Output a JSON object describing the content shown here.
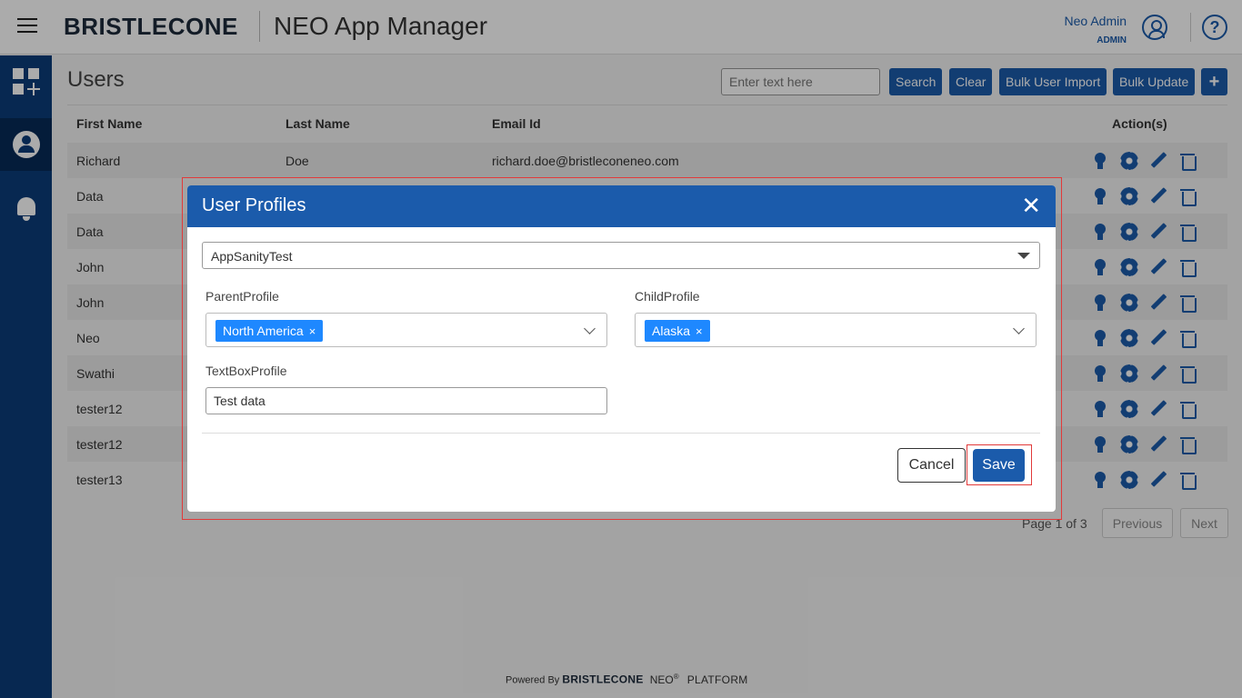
{
  "header": {
    "brand": "BRISTLECONE",
    "app_title": "NEO App Manager",
    "user_name": "Neo Admin",
    "user_role": "ADMIN",
    "help_glyph": "?"
  },
  "sidebar": {
    "items": [
      {
        "icon": "dashboard-add-icon",
        "active": false
      },
      {
        "icon": "users-icon",
        "active": true
      },
      {
        "icon": "bell-icon",
        "active": false
      }
    ]
  },
  "page": {
    "title": "Users",
    "search_placeholder": "Enter text here",
    "search_label": "Search",
    "clear_label": "Clear",
    "bulk_import_label": "Bulk User Import",
    "bulk_update_label": "Bulk Update",
    "add_label": "+"
  },
  "table": {
    "columns": [
      "First Name",
      "Last Name",
      "Email Id",
      "Action(s)"
    ],
    "rows": [
      {
        "first": "Richard",
        "last": "Doe",
        "email": "richard.doe@bristleconeneo.com"
      },
      {
        "first": "Data",
        "last": "",
        "email": ""
      },
      {
        "first": "Data",
        "last": "",
        "email": ""
      },
      {
        "first": "John",
        "last": "",
        "email": ""
      },
      {
        "first": "John",
        "last": "",
        "email": ""
      },
      {
        "first": "Neo",
        "last": "",
        "email": ""
      },
      {
        "first": "Swathi",
        "last": "",
        "email": ""
      },
      {
        "first": "tester12",
        "last": "",
        "email": ""
      },
      {
        "first": "tester12",
        "last": "",
        "email": ""
      },
      {
        "first": "tester13",
        "last": "",
        "email": ""
      }
    ]
  },
  "pagination": {
    "text": "Page 1 of 3",
    "previous_label": "Previous",
    "next_label": "Next"
  },
  "footer": {
    "powered_by": "Powered By",
    "brand": "BRISTLECONE",
    "neo": "NEO",
    "registered": "®",
    "platform": "PLATFORM"
  },
  "modal": {
    "title": "User Profiles",
    "close_glyph": "✕",
    "app_selected": "AppSanityTest",
    "parent_label": "ParentProfile",
    "parent_chip": "North America",
    "child_label": "ChildProfile",
    "child_chip": "Alaska",
    "chip_remove_glyph": "×",
    "textbox_label": "TextBoxProfile",
    "textbox_value": "Test data",
    "cancel_label": "Cancel",
    "save_label": "Save"
  },
  "colors": {
    "primary": "#1b5bab",
    "sidebar": "#0b3d7a",
    "chip": "#1e88ff",
    "highlight": "#e23a3a"
  }
}
